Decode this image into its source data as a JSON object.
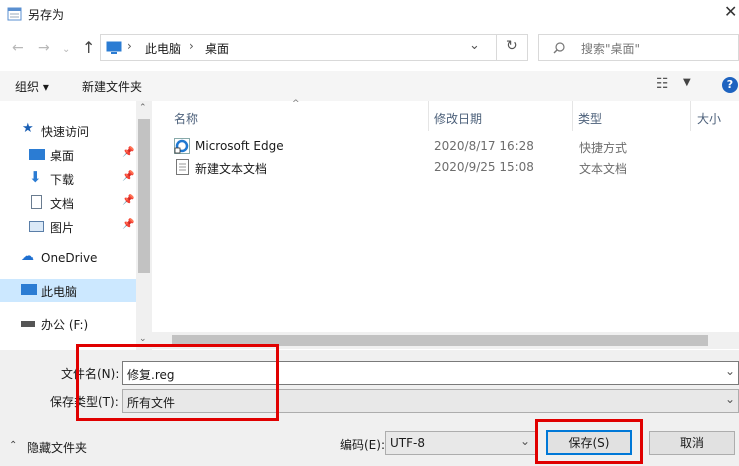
{
  "window": {
    "title": "另存为",
    "close": "✕"
  },
  "address": {
    "crumbs": [
      "此电脑",
      "桌面"
    ],
    "search_placeholder": "搜索\"桌面\""
  },
  "toolbar": {
    "organize": "组织 ▾",
    "new_folder": "新建文件夹"
  },
  "nav": {
    "quick_access": "快速访问",
    "items": [
      "桌面",
      "下载",
      "文档",
      "图片"
    ],
    "onedrive": "OneDrive",
    "this_pc": "此电脑",
    "drive": "办公 (F:)"
  },
  "columns": {
    "name": "名称",
    "date": "修改日期",
    "type": "类型",
    "size": "大小"
  },
  "files": [
    {
      "name": "Microsoft Edge",
      "date": "2020/8/17 16:28",
      "type": "快捷方式"
    },
    {
      "name": "新建文本文档",
      "date": "2020/9/25 15:08",
      "type": "文本文档"
    }
  ],
  "form": {
    "filename_label": "文件名(N):",
    "filename_value": "修复.reg",
    "filetype_label": "保存类型(T):",
    "filetype_value": "所有文件",
    "encoding_label": "编码(E):",
    "encoding_value": "UTF-8",
    "hide_folders": "隐藏文件夹",
    "save": "保存(S)",
    "cancel": "取消"
  },
  "colors": {
    "selection": "#cce8ff",
    "highlight_box": "#e00000",
    "accent": "#0078d7"
  }
}
